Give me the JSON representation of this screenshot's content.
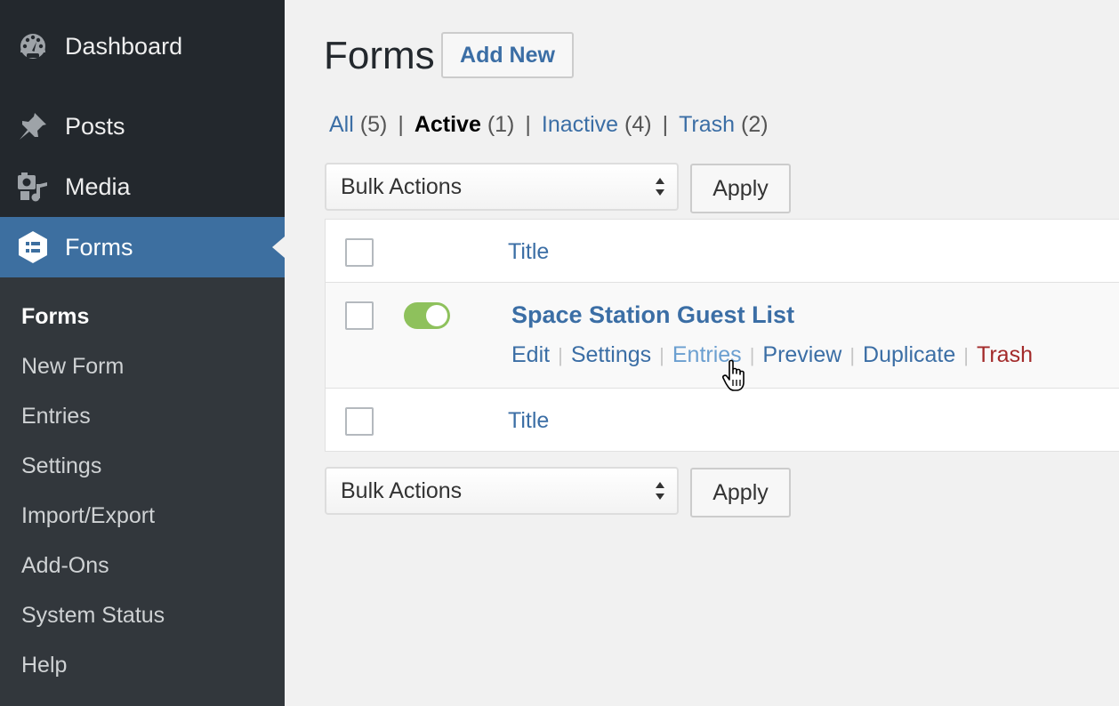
{
  "sidebar": {
    "menu": [
      {
        "label": "Dashboard",
        "icon": "dashboard-icon"
      },
      {
        "label": "Posts",
        "icon": "pin-icon"
      },
      {
        "label": "Media",
        "icon": "media-icon"
      },
      {
        "label": "Forms",
        "icon": "forms-icon",
        "active": true
      }
    ],
    "submenu": [
      "Forms",
      "New Form",
      "Entries",
      "Settings",
      "Import/Export",
      "Add-Ons",
      "System Status",
      "Help"
    ]
  },
  "main": {
    "title": "Forms",
    "add_new": "Add New",
    "views": [
      {
        "label": "All",
        "count": "(5)"
      },
      {
        "label": "Active",
        "count": "(1)",
        "current": true
      },
      {
        "label": "Inactive",
        "count": "(4)"
      },
      {
        "label": "Trash",
        "count": "(2)"
      }
    ],
    "bulk_actions": "Bulk Actions",
    "apply": "Apply",
    "table": {
      "header_title": "Title",
      "footer_title": "Title",
      "rows": [
        {
          "title": "Space Station Guest List",
          "active": true,
          "actions": [
            "Edit",
            "Settings",
            "Entries",
            "Preview",
            "Duplicate",
            "Trash"
          ]
        }
      ]
    }
  },
  "colors": {
    "sidebar_bg": "#23282d",
    "submenu_bg": "#32373c",
    "active_menu": "#3d6fa0",
    "link": "#3b6ea5",
    "trash_link": "#a32a2a",
    "toggle_on": "#8ec15c"
  }
}
